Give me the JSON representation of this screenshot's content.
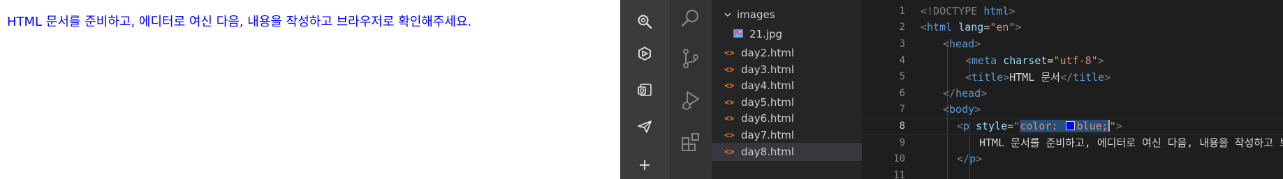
{
  "preview": {
    "paragraph_text": "HTML 문서를 준비하고, 에디터로 여신 다음, 내용을 작성하고 브라우저로 확인해주세요.",
    "paragraph_color": "#0000ff"
  },
  "edge_sidebar": {
    "icons": [
      "search-icon",
      "copilot-icon",
      "outlook-icon",
      "send-icon",
      "add-icon"
    ]
  },
  "activity_bar": {
    "icons": [
      "search-icon",
      "source-control-icon",
      "run-debug-icon",
      "extensions-icon"
    ]
  },
  "explorer": {
    "folder": "images",
    "folder_file": "21.jpg",
    "files": [
      "day2.html",
      "day3.html",
      "day4.html",
      "day5.html",
      "day6.html",
      "day7.html",
      "day8.html"
    ],
    "selected_file": "day8.html",
    "html_icon_glyph": "<>"
  },
  "editor": {
    "line_numbers": [
      "1",
      "2",
      "3",
      "4",
      "5",
      "6",
      "7",
      "8",
      "9",
      "10",
      "11"
    ],
    "current_line": "8",
    "lines": {
      "l1_doctype": "<!DOCTYPE",
      "l1_html": "html",
      "l1_close": ">",
      "l2_open": "<",
      "l2_tag": "html",
      "l2_attr": "lang",
      "l2_eq": "=",
      "l2_val": "\"en\"",
      "l2_close": ">",
      "l3_open": "<",
      "l3_tag": "head",
      "l3_close": ">",
      "l4_open": "<",
      "l4_tag": "meta",
      "l4_attr": "charset",
      "l4_eq": "=",
      "l4_val": "\"utf-8\"",
      "l4_close": ">",
      "l5_open": "<",
      "l5_tag": "title",
      "l5_close": ">",
      "l5_text": "HTML 문서",
      "l5_end_open": "</",
      "l5_end_tag": "title",
      "l5_end_close": ">",
      "l6_open": "</",
      "l6_tag": "head",
      "l6_close": ">",
      "l7_open": "<",
      "l7_tag": "body",
      "l7_close": ">",
      "l8_open": "<",
      "l8_tag": "p",
      "l8_attr": "style",
      "l8_eq": "=",
      "l8_q1": "\"",
      "l8_val_a": "color: ",
      "l8_val_b": "blue;",
      "l8_q2": "\"",
      "l8_close": ">",
      "l9_text": "HTML 문서를 준비하고, 에디터로 여신 다음, 내용을 작성하고 브라우저로 확인해주세요.",
      "l10_open": "</",
      "l10_tag": "p",
      "l10_close": ">"
    },
    "swatch_color": "#0000ff"
  }
}
